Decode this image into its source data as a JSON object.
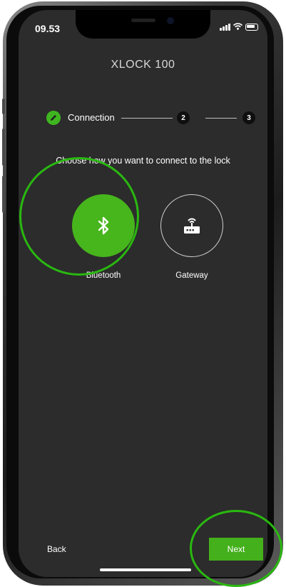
{
  "status_bar": {
    "time": "09.53"
  },
  "header": {
    "title": "XLOCK 100"
  },
  "stepper": {
    "steps": [
      {
        "label": "Connection",
        "state": "completed",
        "icon": "pencil-icon"
      },
      {
        "label": "2",
        "state": "pending"
      },
      {
        "label": "3",
        "state": "pending"
      }
    ]
  },
  "prompt": "Choose how you want to connect to the lock",
  "options": [
    {
      "label": "Bluetooth",
      "icon": "bluetooth-icon",
      "selected": true
    },
    {
      "label": "Gateway",
      "icon": "router-icon",
      "selected": false
    }
  ],
  "footer": {
    "back_label": "Back",
    "next_label": "Next"
  },
  "colors": {
    "accent": "#44b01b",
    "background": "#2c2c2c",
    "annotation": "#29b810"
  }
}
